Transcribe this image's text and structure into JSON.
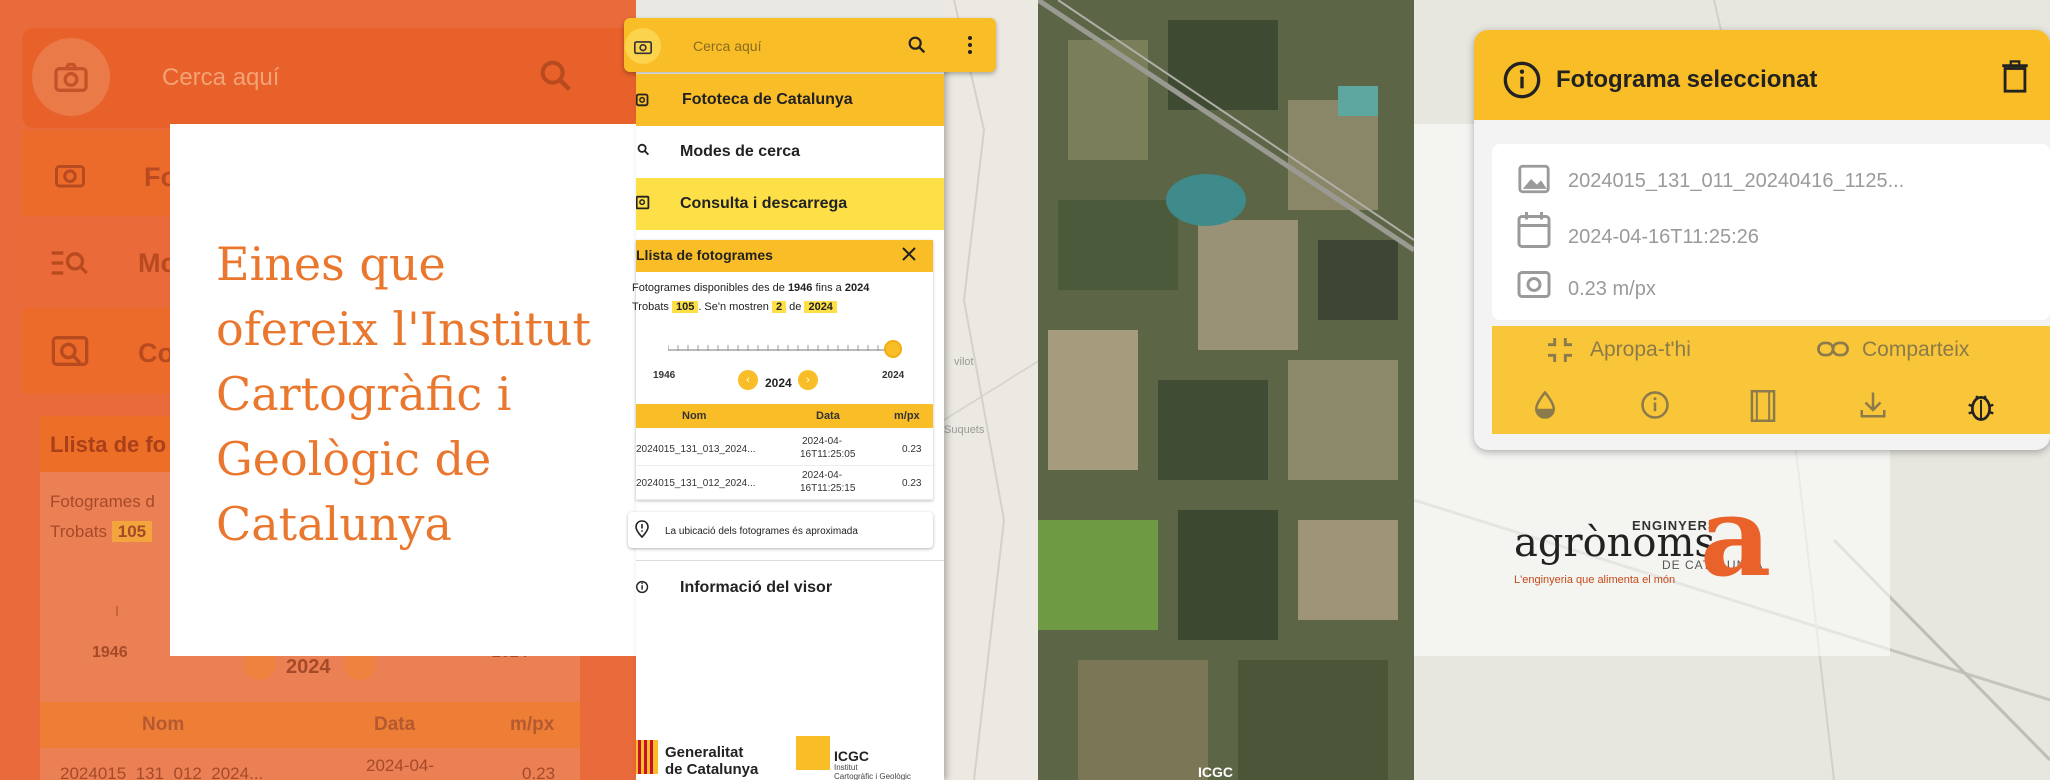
{
  "left_zoom": {
    "search_placeholder": "Cerca aquí",
    "menu_1": "Fo",
    "menu_2": "Mo",
    "menu_3": "Co",
    "panel_title": "Llista de fo",
    "line_1": "Fotogrames d",
    "found_label": "Trobats",
    "found_count": "105",
    "year_min": "1946",
    "year_max": "2024",
    "current_year": "2024",
    "col_nom": "Nom",
    "col_data": "Data",
    "col_mpx": "m/px",
    "row_name": "2024015_131_012_2024...",
    "row_date": "2024-04-",
    "row_mpx": "0.23"
  },
  "title_card": {
    "heading": "Eines que ofereix l'Institut Cartogràfic i Geològic de Catalunya"
  },
  "app": {
    "search_placeholder": "Cerca aquí",
    "menu": {
      "fototeca": "Fototeca de Catalunya",
      "modes": "Modes de cerca",
      "consulta": "Consulta i descarrega",
      "info": "Informació del visor"
    },
    "llista": {
      "title": "Llista de fotogrames",
      "available_prefix": "Fotogrames disponibles des de",
      "year_from": "1946",
      "fins_a": "fins a",
      "year_to": "2024",
      "found_prefix": "Trobats",
      "found_count": "105",
      "showing_prefix": ". Se'n mostren",
      "shown_count": "2",
      "de": "de",
      "shown_year": "2024",
      "slider_min": "1946",
      "slider_max": "2024",
      "slider_value": 2024,
      "current_year": "2024",
      "columns": {
        "nom": "Nom",
        "data": "Data",
        "mpx": "m/px"
      },
      "rows": [
        {
          "nom": "2024015_131_013_2024...",
          "date_1": "2024-04-",
          "date_2": "16T11:25:05",
          "mpx": "0.23"
        },
        {
          "nom": "2024015_131_012_2024...",
          "date_1": "2024-04-",
          "date_2": "16T11:25:15",
          "mpx": "0.23"
        }
      ],
      "location_note": "La ubicació dels fotogrames és aproximada"
    },
    "footer": {
      "gen_line1": "Generalitat",
      "gen_line2": "de Catalunya",
      "icgc": "ICGC",
      "icgc_sub1": "Institut",
      "icgc_sub2": "Cartogràfic i Geològic"
    }
  },
  "map": {
    "label_1": "Suquets",
    "label_2": "vilot",
    "icgc_mark": "ICGC"
  },
  "foto_card": {
    "title": "Fotograma seleccionat",
    "filename": "2024015_131_011_20240416_1125...",
    "datetime": "2024-04-16T11:25:26",
    "resolution": "0.23 m/px",
    "zoom_action": "Apropa-t'hi",
    "share_action": "Comparteix"
  },
  "agronoms": {
    "top": "ENGINYERS",
    "main": "agrònoms",
    "sub": "DE CATALUNYA",
    "tagline": "L'enginyeria que alimenta el món"
  },
  "colors": {
    "orange": "#e9772e",
    "yellow": "#f9bd27",
    "light_yellow": "#fde047"
  }
}
